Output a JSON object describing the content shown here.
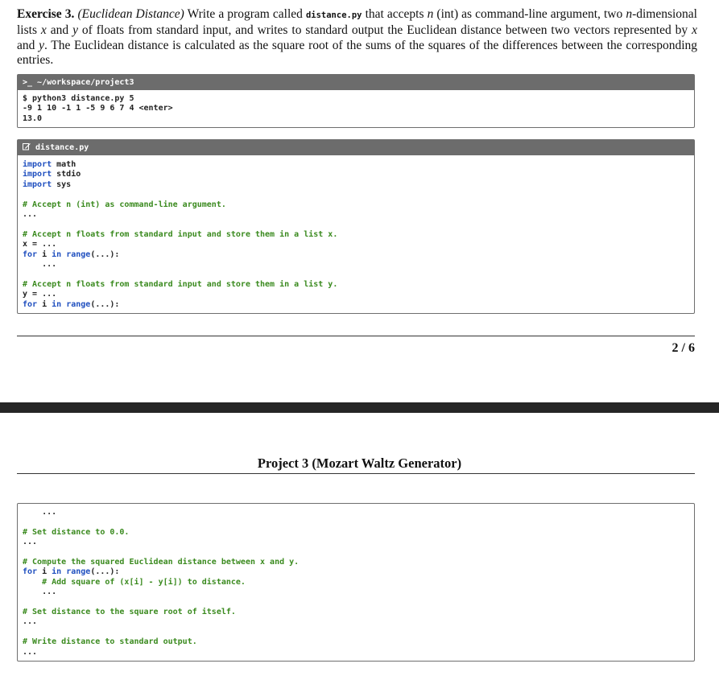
{
  "exercise": {
    "label": "Exercise 3.",
    "title": "(Euclidean Distance)",
    "text_1": " Write a program called ",
    "filename": "distance.py",
    "text_2": " that accepts ",
    "var_n": "n",
    "text_3": " (int) as command-line argument, two ",
    "var_n2": "n",
    "text_4": "-dimensional lists ",
    "var_x": "x",
    "text_5": " and ",
    "var_y": "y",
    "text_6": " of floats from standard input, and writes to standard output the Euclidean distance between two vectors represented by ",
    "var_x2": "x",
    "text_7": " and ",
    "var_y2": "y",
    "text_8": ". The Euclidean distance is calculated as the square root of the sums of the squares of the differences between the corresponding entries."
  },
  "terminal": {
    "title": ">_ ~/workspace/project3",
    "lines": [
      "$ python3 distance.py 5",
      "-9 1 10 -1 1 -5 9 6 7 4 <enter>",
      "13.0"
    ]
  },
  "editor": {
    "title": "distance.py",
    "icon": "edit-icon"
  },
  "page": {
    "number": "2 / 6",
    "next_title": "Project 3 (Mozart Waltz Generator)"
  }
}
